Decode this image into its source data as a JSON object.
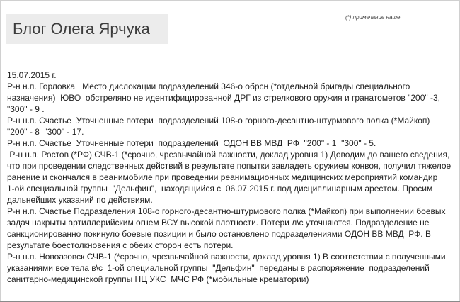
{
  "blog": {
    "title": "Блог Олега Ярчука",
    "note": "(*) примечание наше"
  },
  "report": {
    "lines": [
      "15.07.2015 г.",
      "Р-н н.п. Горловка   Место дислокации подразделений 346-о обрсн (*отдельной бригады специального",
      "назначения)  ЮВО  обстреляно не идентифицированной ДРГ из стрелкового оружия и гранатометов \"200\" -3,",
      "\"300\" - 9 .",
      "Р-н н.п. Счастье  Уточненные потери  подразделений 108-о горного-десантно-штурмового полка (*Майкоп)",
      "\"200\" - 8  \"300\" - 17.",
      "Р-н н.п. Счастье  Уточненные потери  подразделений  ОДОН ВВ МВД  РФ  \"200\" - 1  \"300\" - 5.",
      " Р-н н.п. Ростов (*РФ) СЧВ-1 (*срочно, чрезвычайной важности, доклад уровня 1) Доводим до вашего сведения,",
      "что при проведении следственных действий в результате попытки завладеть оружием конвоя, получил тяжелое",
      "ранение и скончался в реанимобиле при проведении реанимационных медицинских мероприятий командир",
      "1-ой специальной группы  \"Дельфин\",  находящийся с  06.07.2015 г. под дисциплинарным арестом. Просим",
      "дальнейших указаний по действиям.",
      "Р-н н.п. Счастье Подразделения 108-о горного-десантно-штурмового полка (*Майкоп) при выполнении боевых",
      "задач накрыты артиллерийским огнем ВСУ высокой плотности. Потери л\\с уточняются. Подразделение не",
      "санкционированно покинуло боевые позиции и было остановлено подразделениями ОДОН ВВ МВД  РФ. В",
      "результате боестолкновения с обеих сторон есть потери.",
      "Р-н н.п. Новоазовск СЧВ-1 (*срочно, чрезвычайной важности, доклад уровня 1) В соответствии с полученными",
      "указаниями все тела в\\с  1-ой специальной группы  \"Дельфин\"  переданы в распоряжение  подразделений",
      "санитарно-медицинской группы НЦ УКС  МЧС РФ (*мобильные крематории)"
    ]
  }
}
